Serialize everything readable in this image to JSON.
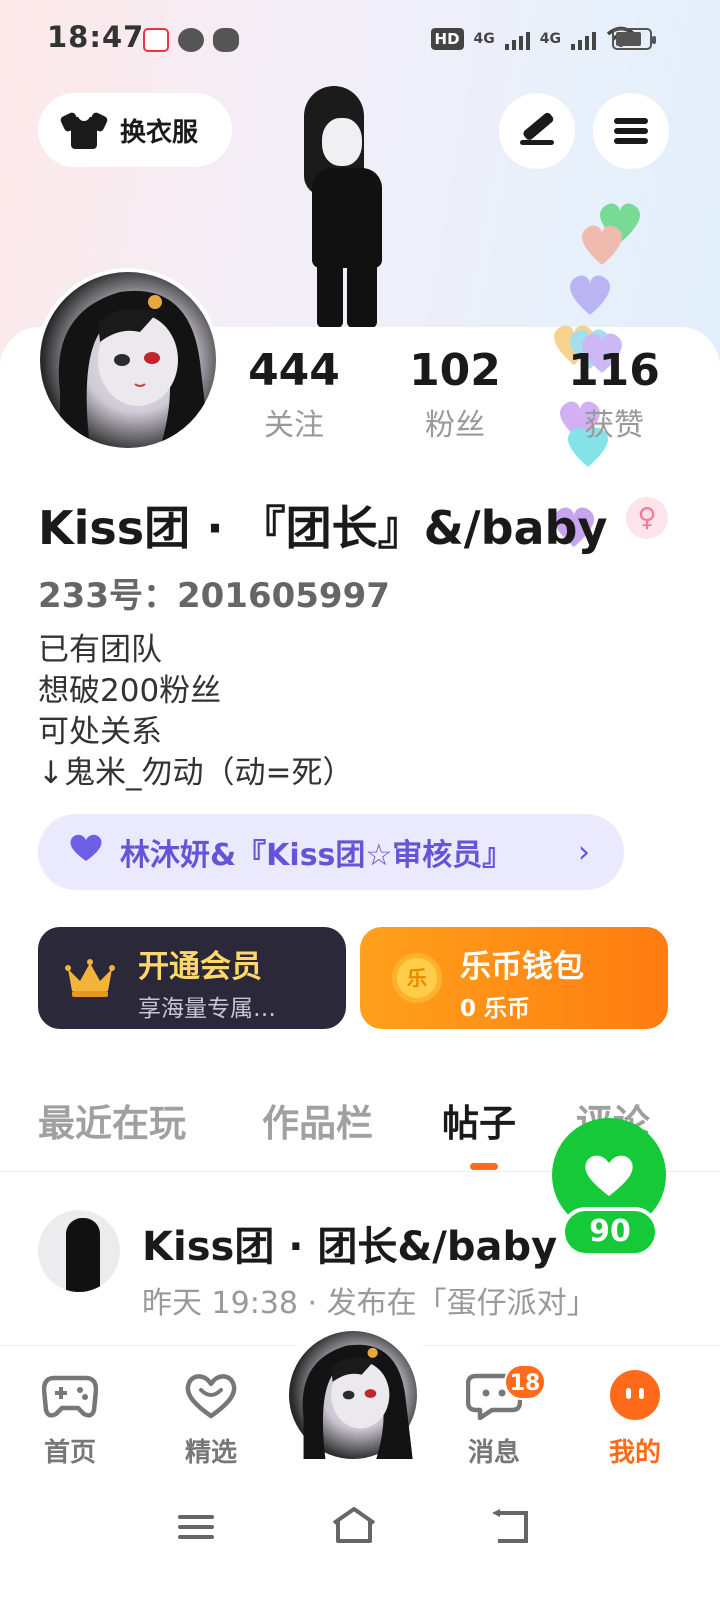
{
  "status_bar": {
    "time": "18:47",
    "hd_label": "HD",
    "net1": "4G",
    "net2": "4G"
  },
  "header": {
    "outfit_label": "换衣服",
    "edit_icon": "pen-icon",
    "menu_icon": "menu-icon"
  },
  "profile": {
    "stats": [
      {
        "value": "444",
        "label": "关注"
      },
      {
        "value": "102",
        "label": "粉丝"
      },
      {
        "value": "116",
        "label": "获赞"
      }
    ],
    "username": "Kiss团 · 『团长』&/baby",
    "gender_symbol": "♀",
    "user_id": "233号：201605997",
    "bio_lines": [
      "已有团队",
      "想破200粉丝",
      "可处关系",
      "↓鬼米_勿动（动=死）"
    ],
    "team_pill": "林沐妍&『Kiss团☆审核员』",
    "team_chevron": "›"
  },
  "cards": {
    "vip": {
      "title": "开通会员",
      "subtitle": "享海量专属…"
    },
    "wallet": {
      "title": "乐币钱包",
      "subtitle": "0 乐币",
      "coin_glyph": "乐"
    }
  },
  "tabs": [
    "最近在玩",
    "作品栏",
    "帖子",
    "评论"
  ],
  "active_tab": "帖子",
  "like_fab": {
    "count": "90"
  },
  "post": {
    "author": "Kiss团 · 团长&/baby",
    "meta": "昨天 19:38 · 发布在「蛋仔派对」"
  },
  "bottom_nav": {
    "items": [
      {
        "label": "首页"
      },
      {
        "label": "精选"
      },
      {
        "label": "消息"
      },
      {
        "label": "我的"
      }
    ],
    "message_badge": "18"
  },
  "colors": {
    "accent": "#ff6b1a",
    "purple": "#6355d8",
    "green": "#15c938",
    "vip_gold": "#ffd86b"
  }
}
